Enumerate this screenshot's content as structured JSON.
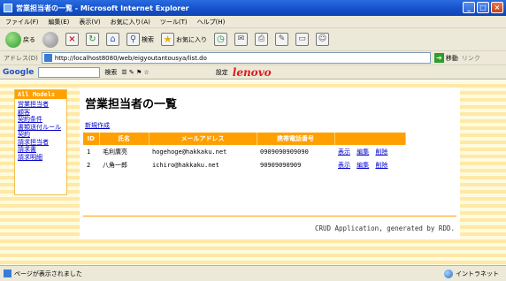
{
  "window": {
    "title": "営業担当者の一覧 - Microsoft Internet Explorer",
    "minimize": "_",
    "maximize": "□",
    "close": "×"
  },
  "menu": [
    "ファイル(F)",
    "編集(E)",
    "表示(V)",
    "お気に入り(A)",
    "ツール(T)",
    "ヘルプ(H)"
  ],
  "toolbar": {
    "back_label": "戻る",
    "search_label": "検索",
    "favorites_label": "お気に入り"
  },
  "address": {
    "label": "アドレス(D)",
    "url": "http://localhost8080/web/eigyoutantousya/list.do",
    "go_label": "移動",
    "links_label": "リンク"
  },
  "google": {
    "logo": "Google",
    "search_label": "検索",
    "settings_label": "設定",
    "brand": "lenovo"
  },
  "sidebar": {
    "heading": "All Models",
    "links": [
      "営業担当者",
      "顧客",
      "契約条件",
      "書類送付ルール",
      "契約",
      "請求担当者",
      "請求書",
      "請求明細"
    ]
  },
  "main": {
    "title": "営業担当者の一覧",
    "new_link": "新規作成",
    "columns": [
      "ID",
      "氏名",
      "メールアドレス",
      "携帯電話番号",
      ""
    ],
    "rows": [
      {
        "id": "1",
        "name": "毛利廣亮",
        "email": "hogehoge@hakkaku.net",
        "phone": "0909090909090"
      },
      {
        "id": "2",
        "name": "八角一郎",
        "email": "ichiro@hakkaku.net",
        "phone": "90909090909"
      }
    ],
    "actions": [
      "表示",
      "編集",
      "削除"
    ],
    "footer": "CRUD Application, generated by RDD."
  },
  "status": {
    "text": "ページが表示されました",
    "zone": "イントラネット"
  }
}
